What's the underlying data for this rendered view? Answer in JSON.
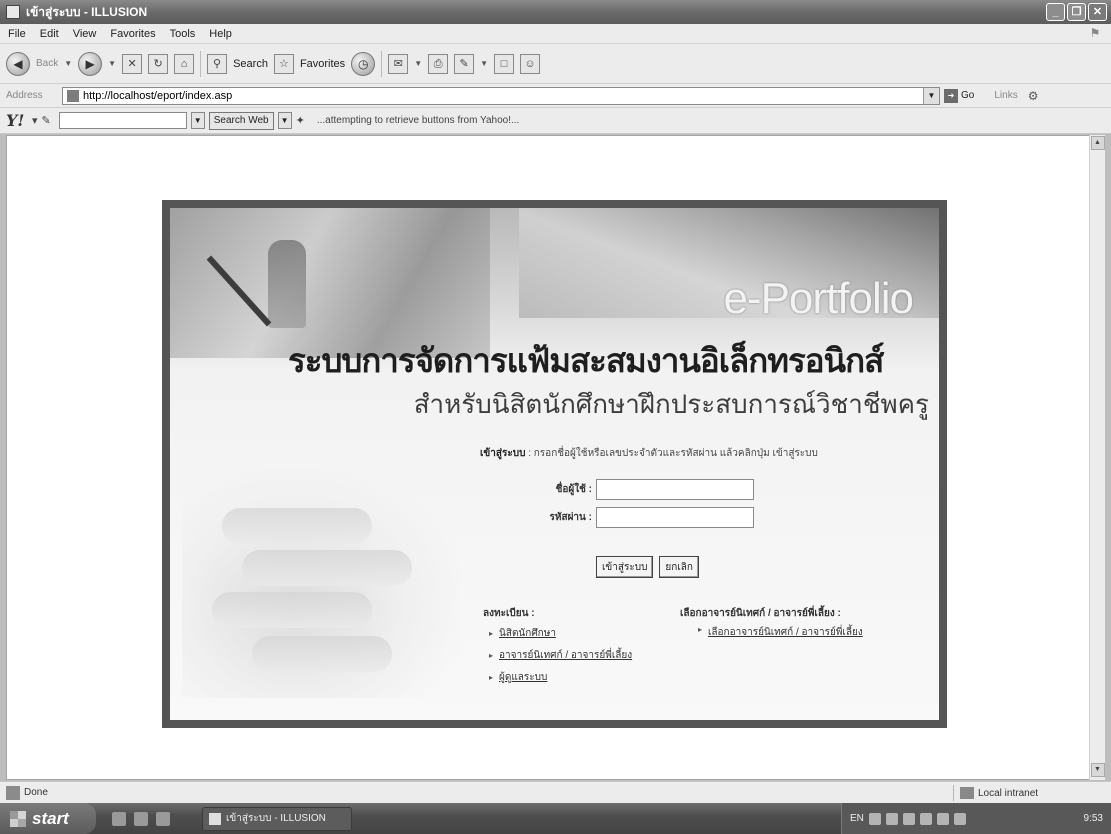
{
  "window": {
    "title": "เข้าสู่ระบบ - ILLUSION",
    "buttons": [
      "_",
      "❐",
      "✕"
    ]
  },
  "menu": [
    "File",
    "Edit",
    "View",
    "Favorites",
    "Tools",
    "Help"
  ],
  "toolbar": {
    "back_label": "Back",
    "search_label": "Search",
    "favorites_label": "Favorites"
  },
  "address": {
    "label": "Address",
    "url": "http://localhost/eport/index.asp",
    "go_label": "Go",
    "links_label": "Links"
  },
  "yahoo": {
    "logo": "Y!",
    "search_button": "Search Web",
    "status": "...attempting to retrieve buttons from Yahoo!..."
  },
  "portal": {
    "brand": "e-Portfolio",
    "title": "ระบบการจัดการแฟ้มสะสมงานอิเล็กทรอนิกส์",
    "subtitle": "สำหรับนิสิตนักศึกษาฝึกประสบการณ์วิชาชีพครู",
    "login_label": "เข้าสู่ระบบ",
    "login_instruction": " : กรอกชื่อผู้ใช้หรือเลขประจำตัวและรหัสผ่าน แล้วคลิกปุ่ม เข้าสู่ระบบ",
    "username_label": "ชื่อผู้ใช้ :",
    "password_label": "รหัสผ่าน :",
    "username_value": "",
    "password_value": "",
    "login_button": "เข้าสู่ระบบ",
    "cancel_button": "ยกเลิก",
    "register": {
      "title": "ลงทะเบียน :",
      "links": [
        "นิสิตนักศึกษา",
        "อาจารย์นิเทศก์ / อาจารย์พี่เลี้ยง",
        "ผู้ดูแลระบบ"
      ]
    },
    "advisor": {
      "title": "เลือกอาจารย์นิเทศก์ / อาจารย์พี่เลี้ยง :",
      "links": [
        "เลือกอาจารย์นิเทศก์ / อาจารย์พี่เลี้ยง"
      ]
    }
  },
  "status": {
    "text": "Done",
    "zone": "Local intranet"
  },
  "taskbar": {
    "start": "start",
    "task": "เข้าสู่ระบบ - ILLUSION",
    "tray_lang": "EN",
    "clock": "9:53"
  }
}
